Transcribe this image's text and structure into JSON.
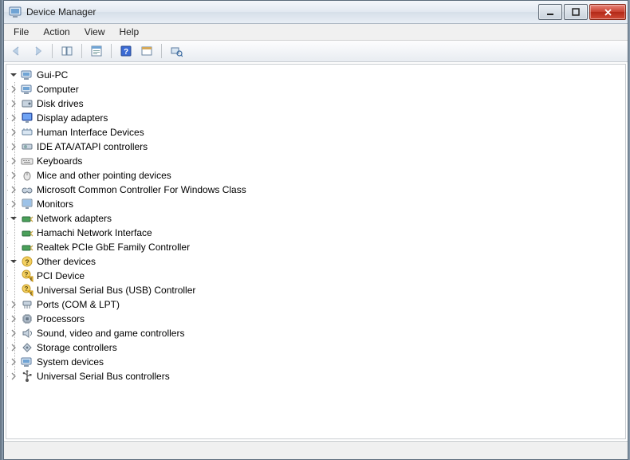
{
  "window": {
    "title": "Device Manager"
  },
  "menu": {
    "file": "File",
    "action": "Action",
    "view": "View",
    "help": "Help"
  },
  "tree": {
    "root": "Gui-PC",
    "computer": "Computer",
    "disk_drives": "Disk drives",
    "display_adapters": "Display adapters",
    "hid": "Human Interface Devices",
    "ide": "IDE ATA/ATAPI controllers",
    "keyboards": "Keyboards",
    "mice": "Mice and other pointing devices",
    "ms_common": "Microsoft Common Controller For Windows Class",
    "monitors": "Monitors",
    "network_adapters": "Network adapters",
    "net_hamachi": "Hamachi Network Interface",
    "net_realtek": "Realtek PCIe GbE Family Controller",
    "other_devices": "Other devices",
    "other_pci": "PCI Device",
    "other_usb": "Universal Serial Bus (USB) Controller",
    "ports": "Ports (COM & LPT)",
    "processors": "Processors",
    "sound": "Sound, video and game controllers",
    "storage": "Storage controllers",
    "system": "System devices",
    "usb": "Universal Serial Bus controllers"
  }
}
